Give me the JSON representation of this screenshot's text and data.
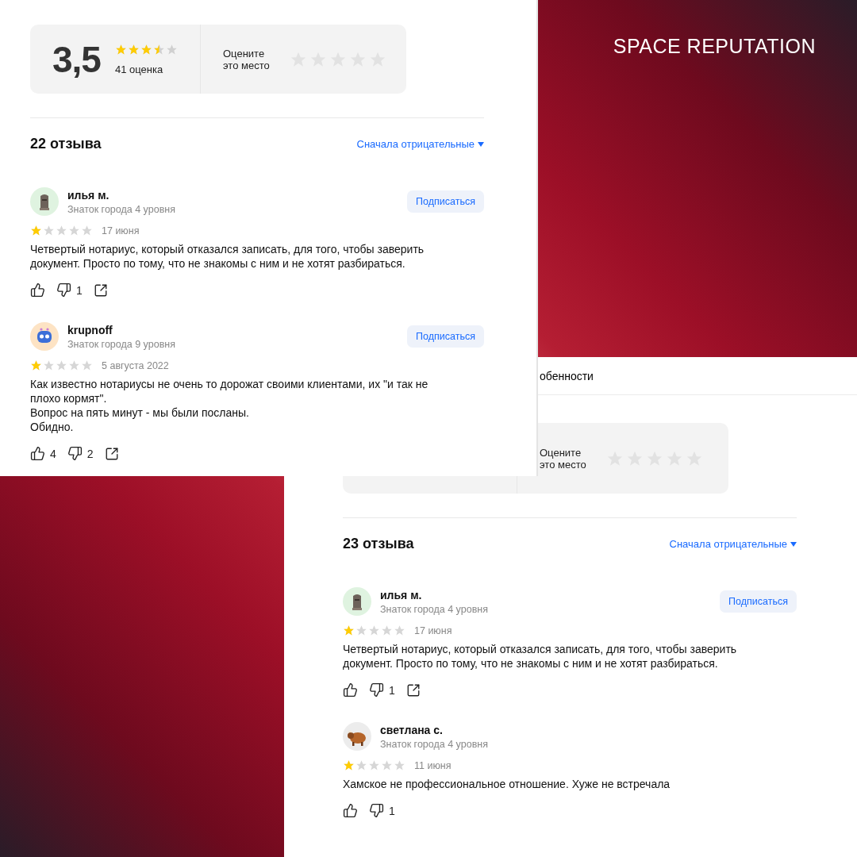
{
  "brand": "SPACE REPUTATION",
  "screens": [
    {
      "rating": {
        "score": "3,5",
        "stars": 3.5,
        "count": "41 оценка"
      },
      "rate": {
        "prompt": "Оцените это место"
      },
      "reviews_count": "22 отзыва",
      "sort": "Сначала отрицательные",
      "reviews": [
        {
          "avatar": {
            "kind": "statue"
          },
          "name": "илья м.",
          "badge": "Знаток города 4 уровня",
          "subscribe": "Подписаться",
          "stars": 1,
          "date": "17 июня",
          "text": "Четвертый нотариус, который отказался записать, для того, чтобы заверить документ. Просто по тому, что не знакомы с ним и не хотят разбираться.",
          "dislikes": "1",
          "share": true
        },
        {
          "avatar": {
            "kind": "robot"
          },
          "name": "krupnoff",
          "badge": "Знаток города 9 уровня",
          "subscribe": "Подписаться",
          "stars": 1,
          "date": "5 августа 2022",
          "text": "Как известно нотариусы не очень то дорожат своими клиентами, их \"и так не плохо кормят\".\nВопрос на пять минут - мы были посланы.\nОбидно.",
          "likes": "4",
          "dislikes": "2",
          "share": true
        }
      ]
    },
    {
      "tab": "обенности",
      "rate": {
        "prompt": "Оцените это место"
      },
      "reviews_count": "23 отзыва",
      "sort": "Сначала отрицательные",
      "reviews": [
        {
          "avatar": {
            "kind": "statue"
          },
          "name": "илья м.",
          "badge": "Знаток города 4 уровня",
          "subscribe": "Подписаться",
          "stars": 1,
          "date": "17 июня",
          "text": "Четвертый нотариус, который отказался записать, для того, чтобы заверить документ. Просто по тому, что не знакомы с ним и не хотят разбираться.",
          "dislikes": "1",
          "share": true
        },
        {
          "avatar": {
            "kind": "yak"
          },
          "name": "светлана с.",
          "badge": "Знаток города 4 уровня",
          "stars": 1,
          "date": "11 июня",
          "text": "Хамское не профессиональное отношение. Хуже не встречала",
          "dislikes": "1",
          "share": false
        }
      ]
    }
  ]
}
